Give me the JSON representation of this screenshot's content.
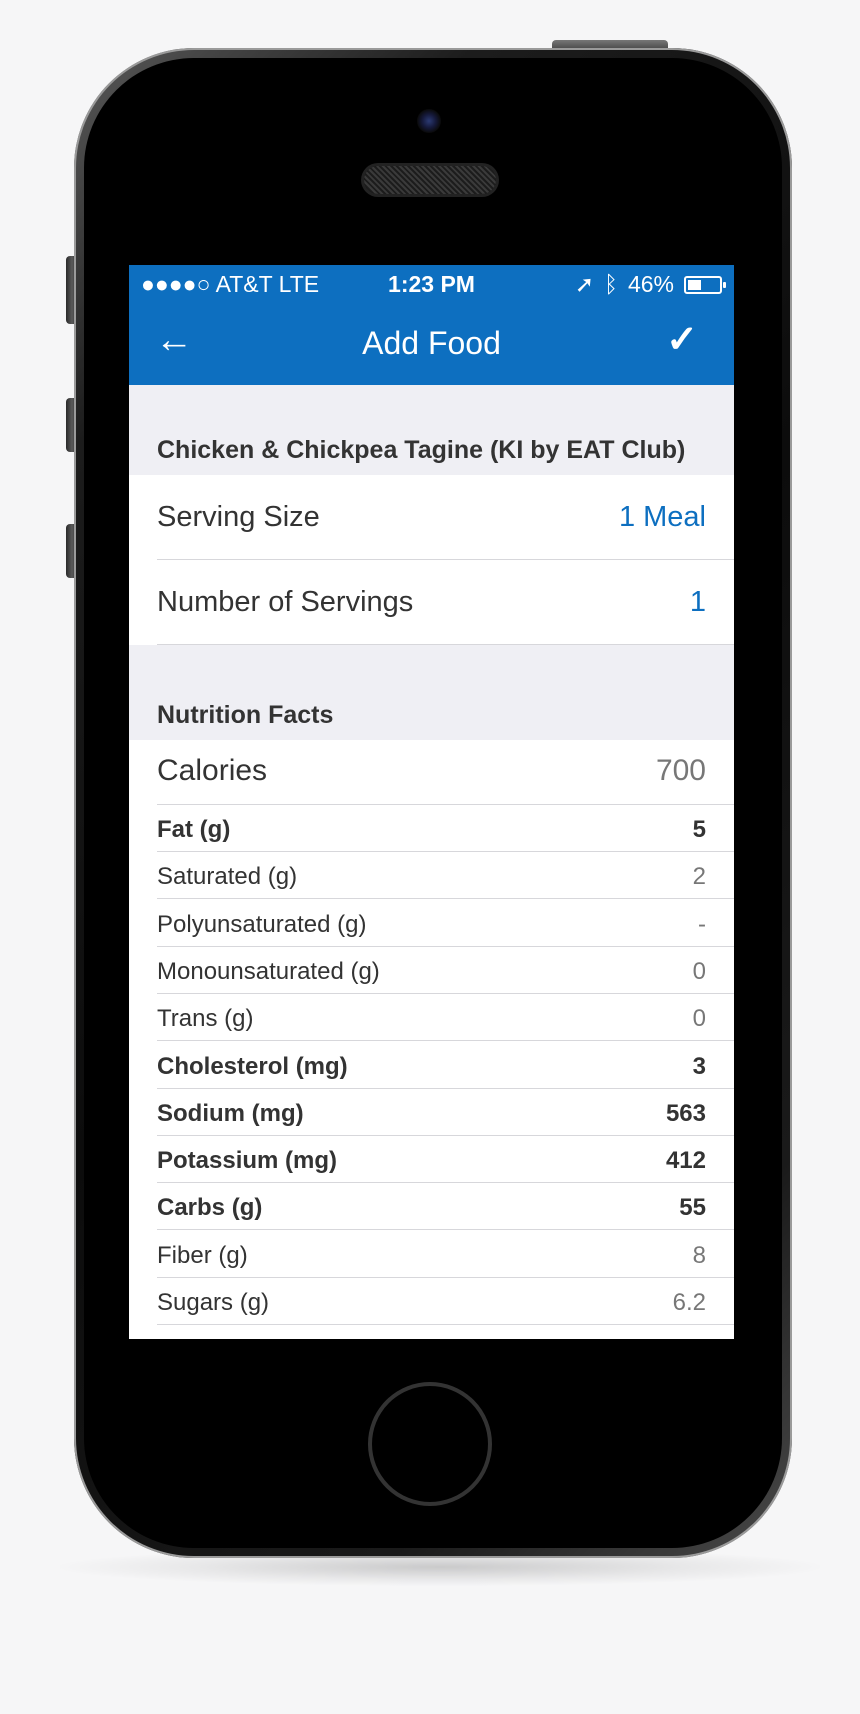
{
  "status_bar": {
    "carrier": "●●●●○ AT&T  LTE",
    "time": "1:23 PM",
    "battery": "46%",
    "battery_level": 0.46
  },
  "nav": {
    "title": "Add Food",
    "back_icon": "←",
    "done_icon": "✓"
  },
  "food": {
    "name": "Chicken & Chickpea Tagine (KI by EAT Club)",
    "serving_size_label": "Serving Size",
    "serving_size_value": "1 Meal",
    "servings_label": "Number of Servings",
    "servings_value": "1"
  },
  "nutrition": {
    "header": "Nutrition Facts",
    "calories_label": "Calories",
    "calories_value": "700",
    "rows": [
      {
        "label": "Fat (g)",
        "value": "5",
        "bold": true
      },
      {
        "label": "Saturated (g)",
        "value": "2",
        "bold": false
      },
      {
        "label": "Polyunsaturated (g)",
        "value": "-",
        "bold": false
      },
      {
        "label": "Monounsaturated (g)",
        "value": "0",
        "bold": false
      },
      {
        "label": "Trans (g)",
        "value": "0",
        "bold": false
      },
      {
        "label": "Cholesterol (mg)",
        "value": "3",
        "bold": true
      },
      {
        "label": "Sodium (mg)",
        "value": "563",
        "bold": true
      },
      {
        "label": "Potassium (mg)",
        "value": "412",
        "bold": true
      },
      {
        "label": "Carbs (g)",
        "value": "55",
        "bold": true
      },
      {
        "label": "Fiber (g)",
        "value": "8",
        "bold": false
      },
      {
        "label": "Sugars (g)",
        "value": "6.2",
        "bold": false
      }
    ]
  },
  "colors": {
    "accent": "#0d6fc0",
    "background": "#efeff4"
  }
}
